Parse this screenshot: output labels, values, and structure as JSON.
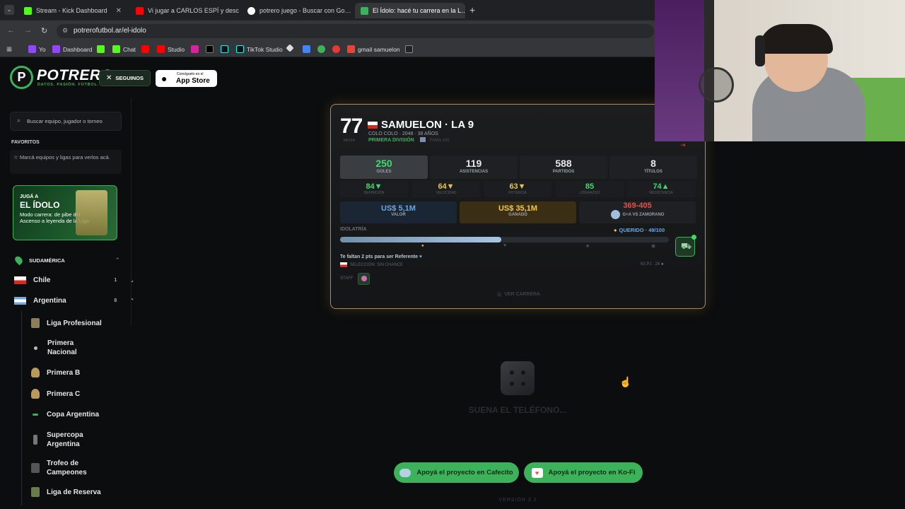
{
  "browser": {
    "tabs": [
      {
        "label": "Stream - Kick Dashboard",
        "icon": "kick-icon"
      },
      {
        "label": "Vi jugar a CARLOS ESPÍ y desc…",
        "icon": "youtube-icon"
      },
      {
        "label": "potrero juego - Buscar con Go…",
        "icon": "google-icon"
      },
      {
        "label": "El Ídolo: hacé tu carrera en la L…",
        "icon": "potrero-icon"
      }
    ],
    "url": "potrerofutbol.ar/el-idolo",
    "bookmarks": [
      "Yo",
      "Dashboard",
      "",
      "Chat",
      "",
      "Studio",
      "",
      "",
      "",
      "TikTok Studio",
      "",
      "",
      "",
      "",
      "gmail samuelon",
      ""
    ]
  },
  "header": {
    "brand": "POTRERO",
    "tagline": "DATOS. PASIÓN. FÚTBOL.",
    "follow_label": "SEGUINOS",
    "appstore_small": "Consíguelo en el",
    "appstore_big": "App Store"
  },
  "sidebar": {
    "search_placeholder": "Buscar equipo, jugador o torneo",
    "favorites_title": "FAVORITOS",
    "favorites_hint": "Marcá equipos y ligas para verlos acá.",
    "promo": {
      "line1": "JUGÁ A",
      "line2": "EL ÍDOLO",
      "text": "Modo carrera: de pibe del Ascenso a leyenda de la Liga"
    },
    "region": "SUDAMÉRICA",
    "countries": [
      {
        "name": "Chile",
        "count": "1"
      },
      {
        "name": "Argentina",
        "count": "8"
      }
    ],
    "leagues": [
      "Liga Profesional",
      "Primera Nacional",
      "Primera B",
      "Primera C",
      "Copa Argentina",
      "Supercopa Argentina",
      "Trofeo de Campeones",
      "Liga de Reserva"
    ]
  },
  "card": {
    "rating": "77",
    "rating_label": "MEDIA",
    "name": "SAMUELON · LA 9",
    "club_line": "COLO COLO · 2048 · 38 AÑOS",
    "division": "PRIMERA DIVISIÓN",
    "fame": "FAMA 100",
    "stats": [
      {
        "value": "250",
        "label": "GOLES"
      },
      {
        "value": "119",
        "label": "ASISTENCIAS"
      },
      {
        "value": "588",
        "label": "PARTIDOS"
      },
      {
        "value": "8",
        "label": "TÍTULOS"
      }
    ],
    "attributes": [
      {
        "value": "84▼",
        "label": "DEFINICIÓN",
        "color": "#3ddc6a"
      },
      {
        "value": "64▼",
        "label": "VELOCIDAD",
        "color": "#e8c34a"
      },
      {
        "value": "63▼",
        "label": "POTENCIA",
        "color": "#e8c34a"
      },
      {
        "value": "85",
        "label": "LIDERAZGO",
        "color": "#3ddc6a"
      },
      {
        "value": "74▲",
        "label": "RESISTENCIA",
        "color": "#3ddc6a"
      }
    ],
    "value": {
      "amount": "US$ 5,1M",
      "label": "VALOR"
    },
    "earned": {
      "amount": "US$ 35,1M",
      "label": "GANADO"
    },
    "rivalry": {
      "score": "369-405",
      "label": "G+A VS ZAMORANO"
    },
    "idolatry_label": "IDOLATRÍA",
    "idolatry_status": "QUERIDO · 49/100",
    "idolatry_progress": 0.49,
    "next_step": "Te faltan 2 pts para ser Referente",
    "national_team": "SELECCIÓN: SIN CHANCE",
    "career_stats": "63 PJ · 26",
    "staff_label": "STAFF",
    "view_career": "VER CARRERA"
  },
  "event": {
    "text": "SUENA EL TELÉFONO..."
  },
  "support": {
    "cafecito": "Apoyá el proyecto en Cafecito",
    "kofi": "Apoyá el proyecto en Ko-Fi"
  },
  "version": "VERSIÓN 3.2",
  "colors": {
    "accent": "#3cb25a",
    "gold": "#b08a4a",
    "blue": "#6aa9e0",
    "red": "#e0544b"
  }
}
